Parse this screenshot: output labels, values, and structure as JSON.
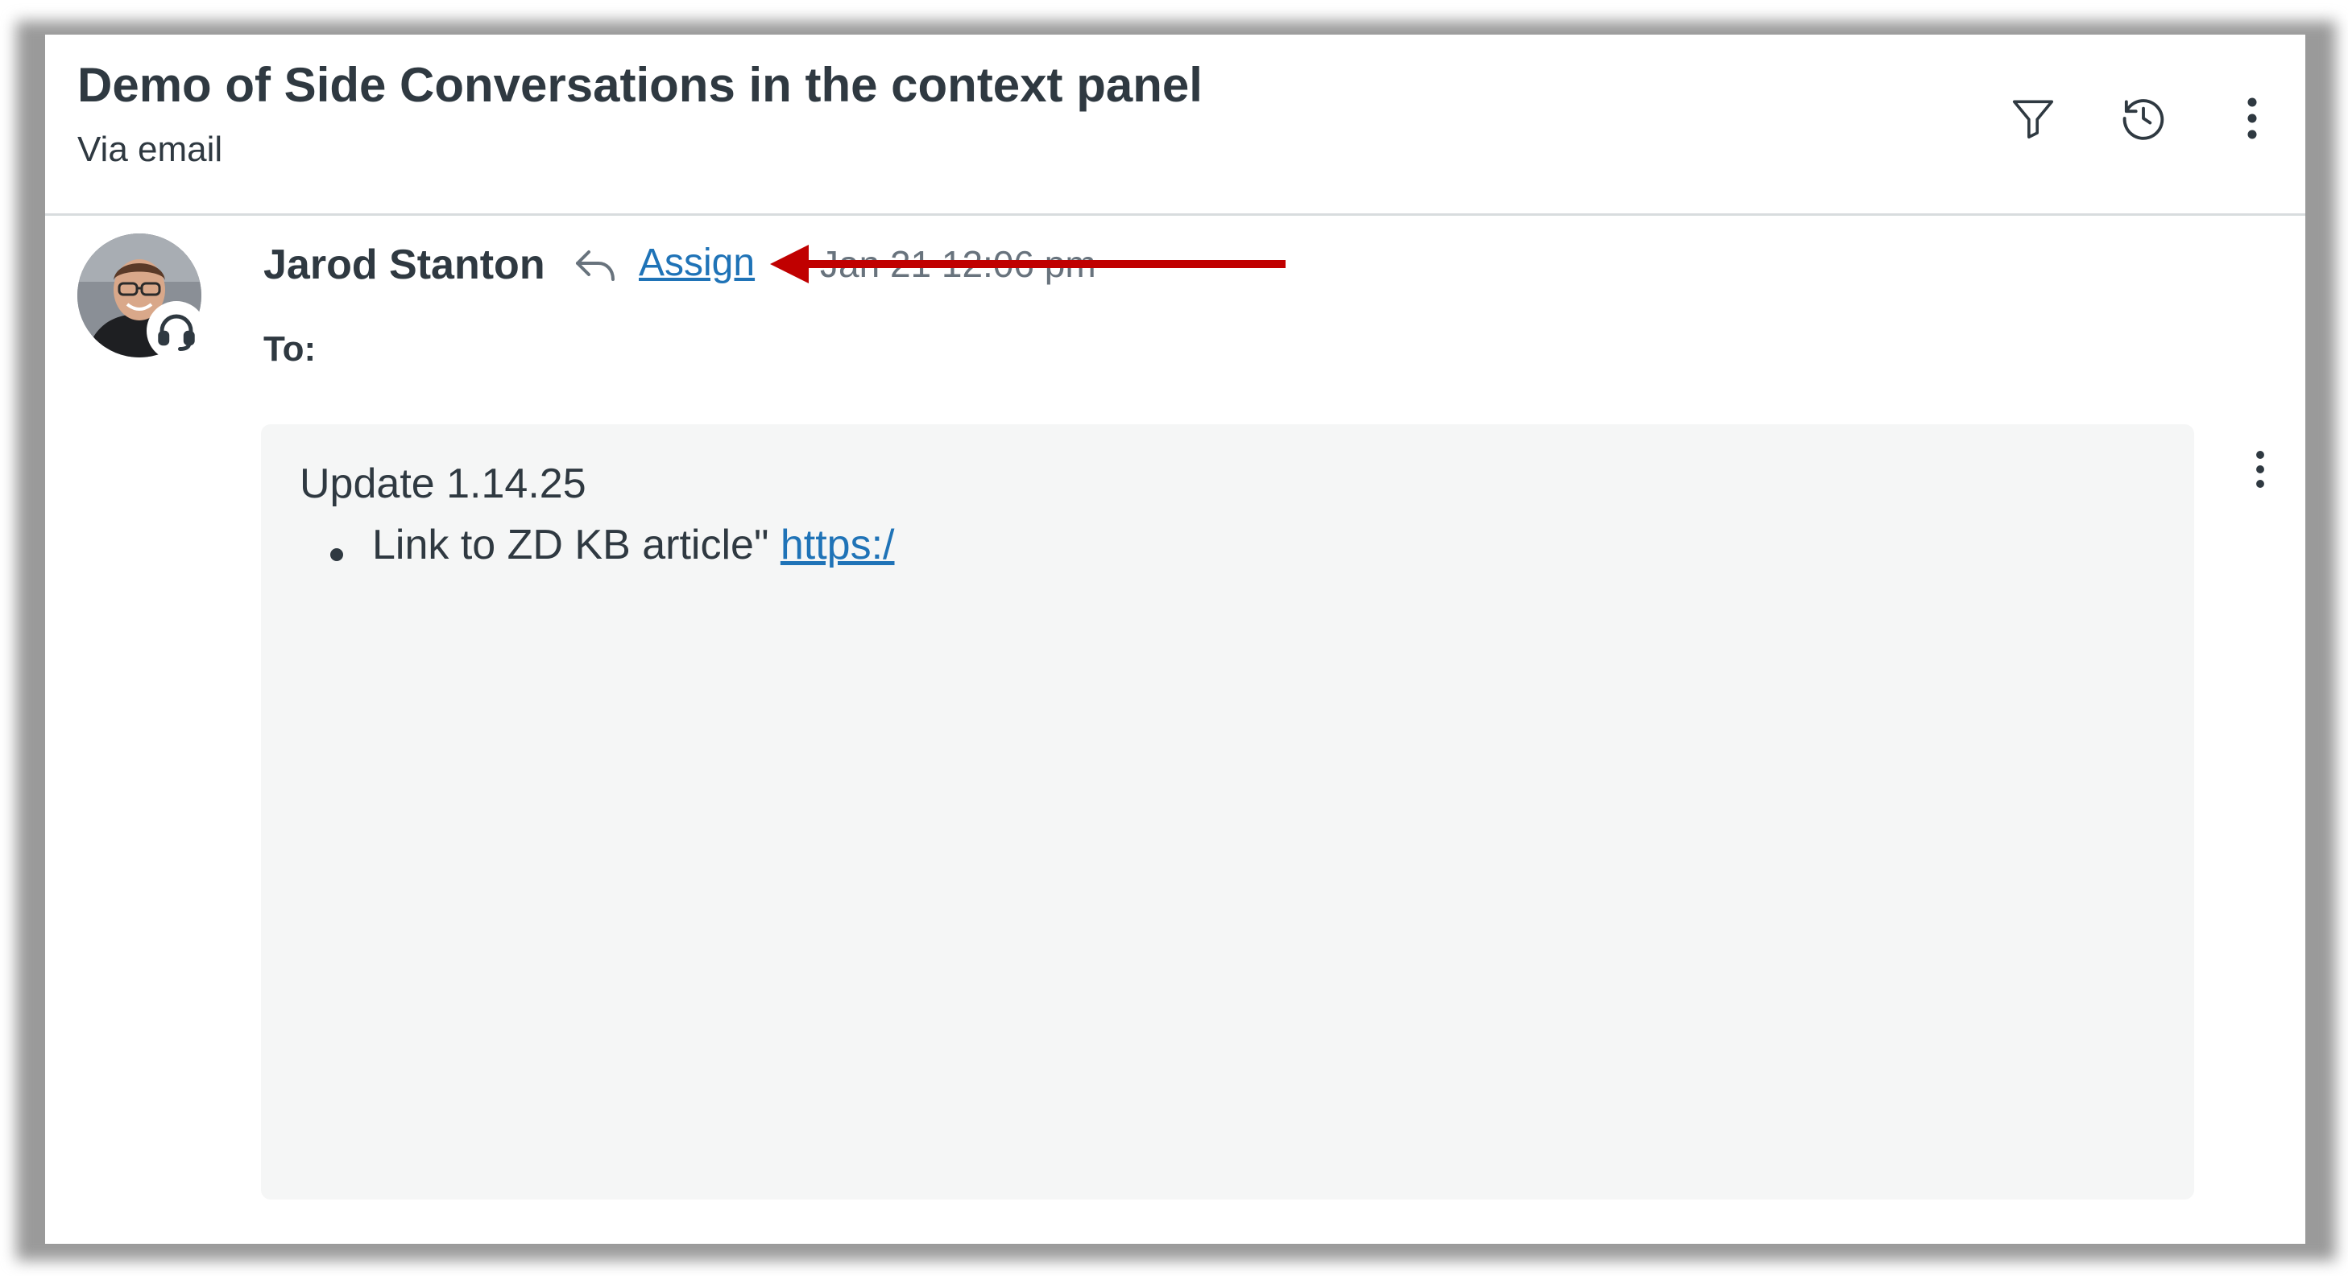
{
  "header": {
    "title": "Demo of Side Conversations in the context panel",
    "subtitle": "Via email",
    "icons": [
      "filter-icon",
      "history-icon",
      "more-vertical-icon"
    ]
  },
  "message": {
    "sender_name": "Jarod Stanton",
    "assign_label": "Assign",
    "timestamp": "Jan 21 12:06 pm",
    "to_label": "To:",
    "body_line1": "Update 1.14.25",
    "bullet_text": "Link to ZD KB article\" ",
    "bullet_link": "https:/"
  },
  "colors": {
    "link": "#1f73b7",
    "text": "#2f3941",
    "annotation_arrow": "#c00000",
    "message_background": "#f5f6f6"
  }
}
